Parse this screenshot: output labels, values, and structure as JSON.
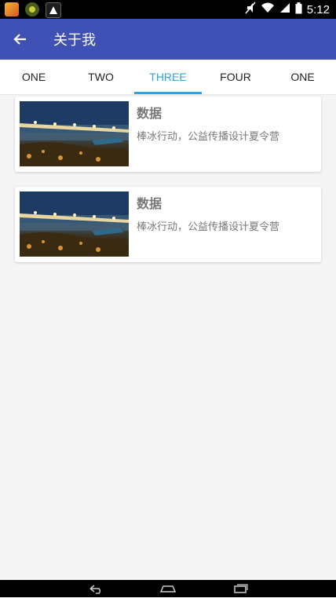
{
  "status_bar": {
    "time": "5:12",
    "icons": [
      "app-notification-icon",
      "app-notification-icon",
      "app-notification-icon",
      "mute-icon",
      "wifi-icon",
      "signal-icon",
      "battery-icon"
    ]
  },
  "app_bar": {
    "title": "关于我",
    "background_color": "#3f51b5"
  },
  "tabs": {
    "items": [
      "ONE",
      "TWO",
      "THREE",
      "FOUR",
      "ONE"
    ],
    "selected_index": 2,
    "accent_color": "#2aa5de"
  },
  "cards": [
    {
      "title": "数据",
      "description": "棒冰行动，公益传播设计夏令营"
    },
    {
      "title": "数据",
      "description": "棒冰行动，公益传播设计夏令营"
    }
  ],
  "nav_bar": {
    "buttons": [
      "back-icon",
      "home-icon",
      "recents-icon"
    ]
  }
}
